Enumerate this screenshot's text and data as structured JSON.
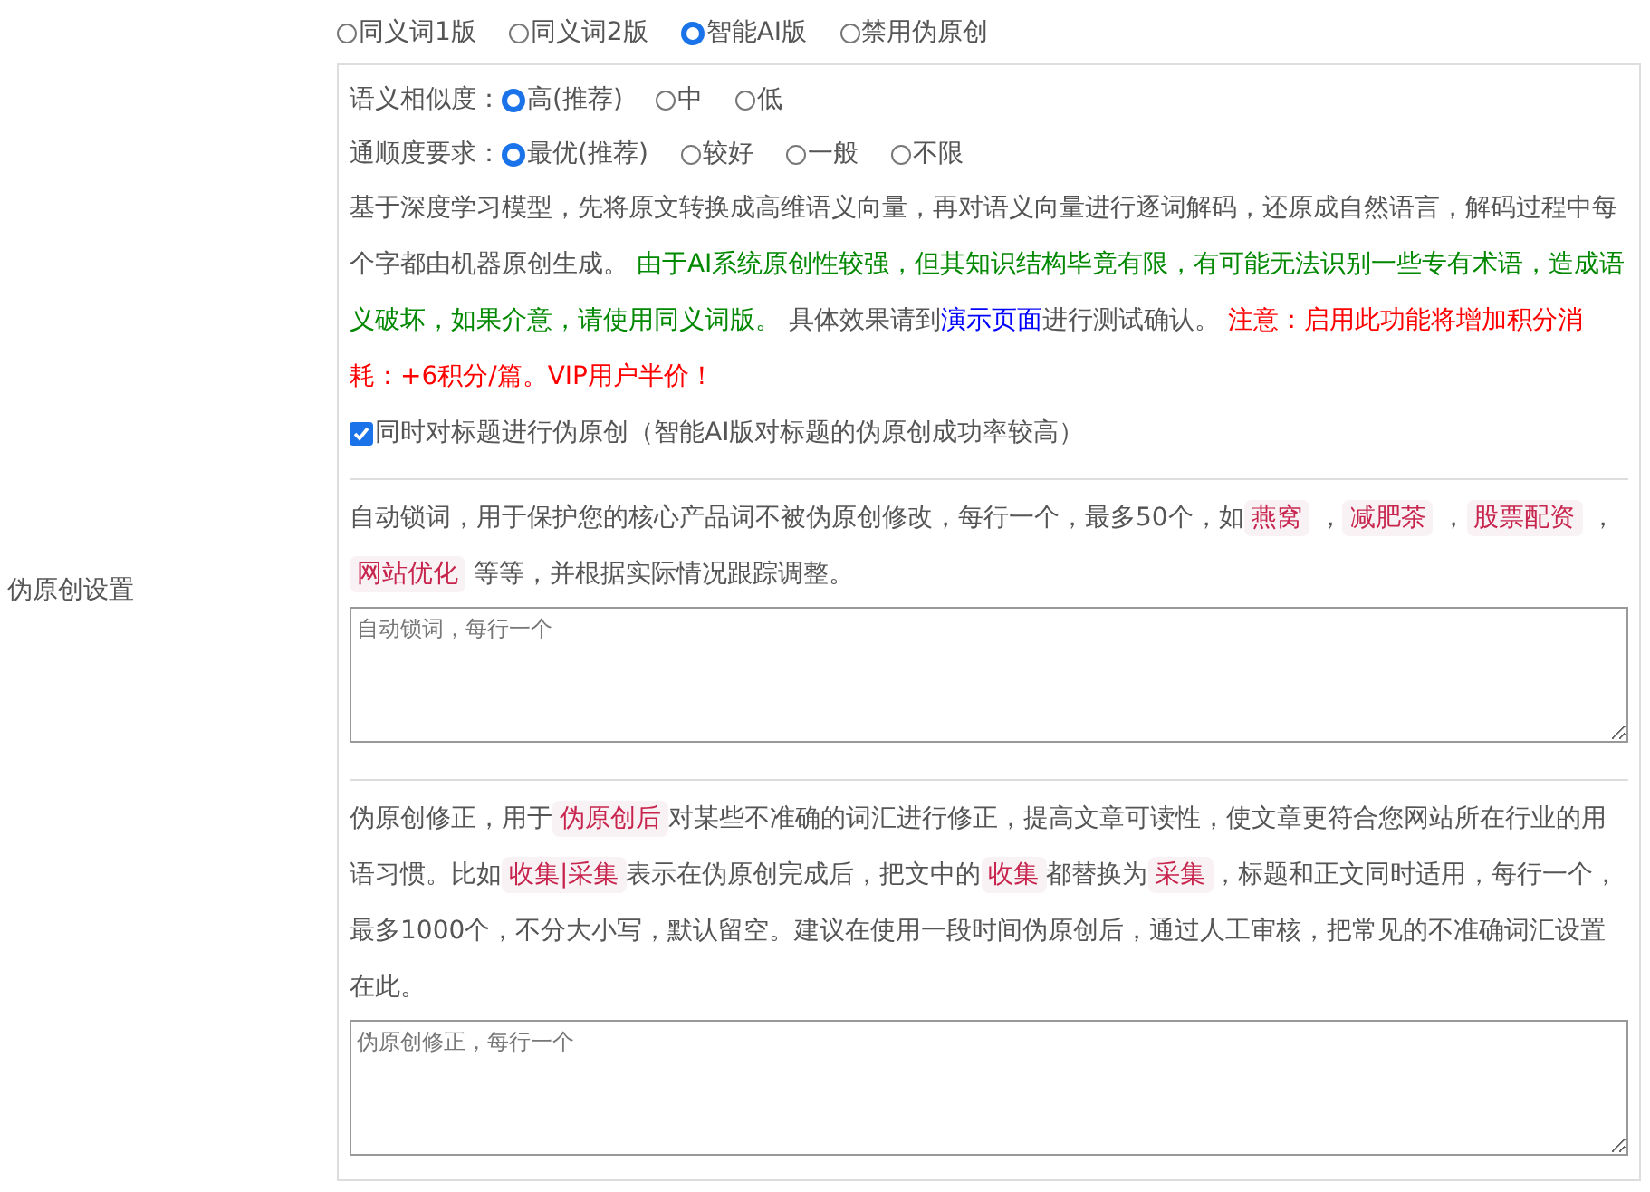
{
  "section_label": "伪原创设置",
  "mode_options": [
    {
      "label": "同义词1版",
      "selected": false
    },
    {
      "label": "同义词2版",
      "selected": false
    },
    {
      "label": "智能AI版",
      "selected": true
    },
    {
      "label": "禁用伪原创",
      "selected": false
    }
  ],
  "similarity": {
    "label": "语义相似度：",
    "options": [
      {
        "label": "高(推荐)",
        "selected": true
      },
      {
        "label": "中",
        "selected": false
      },
      {
        "label": "低",
        "selected": false
      }
    ]
  },
  "fluency": {
    "label": "通顺度要求：",
    "options": [
      {
        "label": "最优(推荐)",
        "selected": true
      },
      {
        "label": "较好",
        "selected": false
      },
      {
        "label": "一般",
        "selected": false
      },
      {
        "label": "不限",
        "selected": false
      }
    ]
  },
  "description": [
    {
      "kind": "text",
      "text": "基于深度学习模型，先将原文转换成高维语义向量，再对语义向量进行逐词解码，还原成自然语言，解码过程中每个字都由机器原创生成。 "
    },
    {
      "kind": "note",
      "text": "由于AI系统原创性较强，但其知识结构毕竟有限，有可能无法识别一些专有术语，造成语义破坏，如果介意，请使用同义词版。"
    },
    {
      "kind": "text",
      "text": " 具体效果请到"
    },
    {
      "kind": "link",
      "text": "演示页面"
    },
    {
      "kind": "text",
      "text": "进行测试确认。 "
    },
    {
      "kind": "warning",
      "text": "注意：启用此功能将增加积分消耗：+6积分/篇。VIP用户半价！"
    }
  ],
  "title_option": {
    "label": "同时对标题进行伪原创（智能AI版对标题的伪原创成功率较高）",
    "checked": true
  },
  "lock_words": {
    "segments": [
      {
        "kind": "text",
        "text": "自动锁词，用于保护您的核心产品词不被伪原创修改，每行一个，最多50个，如"
      },
      {
        "kind": "tag",
        "text": "燕窝"
      },
      {
        "kind": "text",
        "text": " ，"
      },
      {
        "kind": "tag",
        "text": "减肥茶"
      },
      {
        "kind": "text",
        "text": " ，"
      },
      {
        "kind": "tag",
        "text": "股票配资"
      },
      {
        "kind": "text",
        "text": " ，"
      },
      {
        "kind": "tag",
        "text": "网站优化"
      },
      {
        "kind": "text",
        "text": " 等等，并根据实际情况跟踪调整。"
      }
    ],
    "placeholder": "自动锁词，每行一个"
  },
  "correction": {
    "segments": [
      {
        "kind": "text",
        "text": "伪原创修正，用于"
      },
      {
        "kind": "tag",
        "text": "伪原创后"
      },
      {
        "kind": "text",
        "text": "对某些不准确的词汇进行修正，提高文章可读性，使文章更符合您网站所在行业的用语习惯。比如"
      },
      {
        "kind": "tag",
        "text": "收集|采集"
      },
      {
        "kind": "text",
        "text": "表示在伪原创完成后，把文中的"
      },
      {
        "kind": "tag",
        "text": "收集"
      },
      {
        "kind": "text",
        "text": "都替换为"
      },
      {
        "kind": "tag",
        "text": "采集"
      },
      {
        "kind": "text",
        "text": "，标题和正文同时适用，每行一个，最多1000个，不分大小写，默认留空。建议在使用一段时间伪原创后，通过人工审核，把常见的不准确词汇设置在此。"
      }
    ],
    "placeholder": "伪原创修正，每行一个"
  }
}
